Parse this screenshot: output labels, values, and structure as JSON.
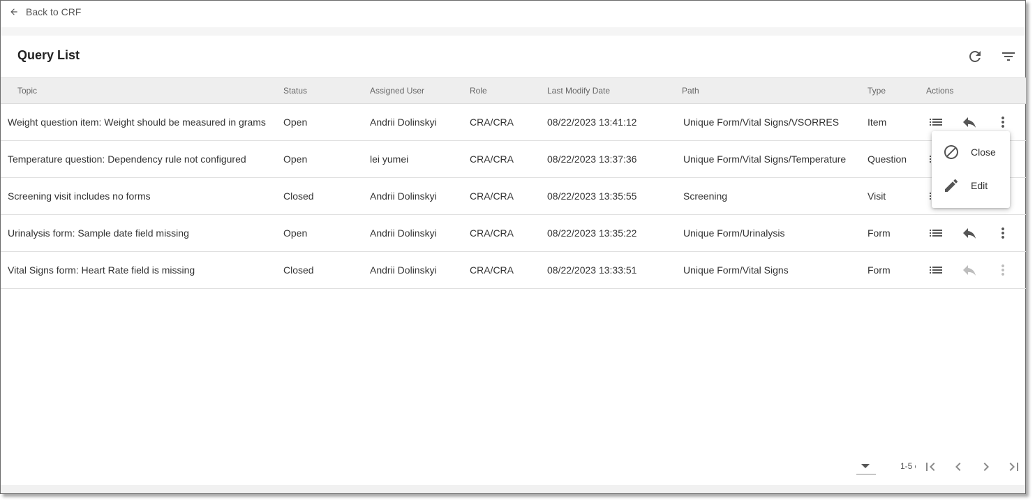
{
  "back_link": {
    "label": "Back to CRF"
  },
  "header": {
    "title": "Query List",
    "refresh_icon": "refresh-icon",
    "filter_icon": "filter-icon"
  },
  "table": {
    "columns": [
      "Topic",
      "Status",
      "Assigned User",
      "Role",
      "Last Modify Date",
      "Path",
      "Type",
      "Actions"
    ],
    "rows": [
      {
        "topic": "Weight question item: Weight should be measured in grams",
        "status": "Open",
        "user": "Andrii Dolinskyi",
        "role": "CRA/CRA",
        "date": "08/22/2023 13:41:12",
        "path": "Unique Form/Vital Signs/VSORRES",
        "type": "Item"
      },
      {
        "topic": "Temperature question: Dependency rule not configured",
        "status": "Open",
        "user": "lei yumei",
        "role": "CRA/CRA",
        "date": "08/22/2023 13:37:36",
        "path": "Unique Form/Vital Signs/Temperature",
        "type": "Question"
      },
      {
        "topic": "Screening visit includes no forms",
        "status": "Closed",
        "user": "Andrii Dolinskyi",
        "role": "CRA/CRA",
        "date": "08/22/2023 13:35:55",
        "path": "Screening",
        "type": "Visit"
      },
      {
        "topic": "Urinalysis form: Sample date field missing",
        "status": "Open",
        "user": "Andrii Dolinskyi",
        "role": "CRA/CRA",
        "date": "08/22/2023 13:35:22",
        "path": "Unique Form/Urinalysis",
        "type": "Form"
      },
      {
        "topic": "Vital Signs form: Heart Rate field is missing",
        "status": "Closed",
        "user": "Andrii Dolinskyi",
        "role": "CRA/CRA",
        "date": "08/22/2023 13:33:51",
        "path": "Unique Form/Vital Signs",
        "type": "Form"
      }
    ]
  },
  "context_menu": {
    "items": [
      {
        "label": "Close",
        "icon": "block-icon"
      },
      {
        "label": "Edit",
        "icon": "pencil-icon"
      }
    ]
  },
  "paginator": {
    "range_label": "1-5 c"
  },
  "colors": {
    "icon_active": "#555555",
    "icon_disabled": "#bdbdbd",
    "header_bg": "#eeeeee"
  }
}
